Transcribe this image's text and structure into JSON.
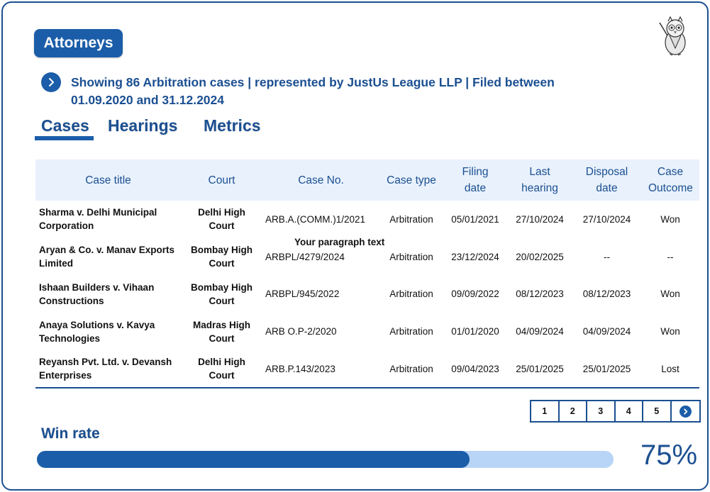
{
  "header": {
    "title": "Attorneys",
    "summary_line1": "Showing 86 Arbitration cases | represented by JustUs League LLP | Filed between",
    "summary_line2": "01.09.2020 and 31.12.2024"
  },
  "icons": {
    "logo": "owl-professor-icon",
    "summary": "chevron-right-icon",
    "next_page": "chevron-right-icon"
  },
  "colors": {
    "brand": "#1b5da8",
    "brand_dark": "#1b4f91",
    "header_bg": "#e8f1fc",
    "bar_track": "#b8d5f7"
  },
  "tabs": [
    {
      "label": "Cases",
      "active": true
    },
    {
      "label": "Hearings",
      "active": false
    },
    {
      "label": "Metrics",
      "active": false
    }
  ],
  "table": {
    "headers": [
      "Case title",
      "Court",
      "Case No.",
      "Case type",
      "Filing date",
      "Last hearing",
      "Disposal date",
      "Case Outcome"
    ],
    "rows": [
      {
        "title": "Sharma v. Delhi Municipal Corporation",
        "court": "Delhi High Court",
        "case_no": "ARB.A.(COMM.)1/2021",
        "type": "Arbitration",
        "filing": "05/01/2021",
        "last_hearing": "27/10/2024",
        "disposal": "27/10/2024",
        "outcome": "Won"
      },
      {
        "title": "Aryan & Co. v. Manav Exports Limited",
        "court": "Bombay High Court",
        "case_no": "ARBPL/4279/2024",
        "type": "Arbitration",
        "filing": "23/12/2024",
        "last_hearing": "20/02/2025",
        "disposal": "--",
        "outcome": "--"
      },
      {
        "title": "Ishaan Builders v. Vihaan Constructions",
        "court": "Bombay High Court",
        "case_no": "ARBPL/945/2022",
        "type": "Arbitration",
        "filing": "09/09/2022",
        "last_hearing": "08/12/2023",
        "disposal": "08/12/2023",
        "outcome": "Won"
      },
      {
        "title": "Anaya Solutions v. Kavya Technologies",
        "court": "Madras High Court",
        "case_no": "ARB O.P-2/2020",
        "type": "Arbitration",
        "filing": "01/01/2020",
        "last_hearing": "04/09/2024",
        "disposal": "04/09/2024",
        "outcome": "Won"
      },
      {
        "title": "Reyansh Pvt. Ltd. v. Devansh Enterprises",
        "court": "Delhi High Court",
        "case_no": "ARB.P.143/2023",
        "type": "Arbitration",
        "filing": "09/04/2023",
        "last_hearing": "25/01/2025",
        "disposal": "25/01/2025",
        "outcome": "Lost"
      }
    ],
    "overlay_text": "Your paragraph text"
  },
  "pagination": {
    "pages": [
      "1",
      "2",
      "3",
      "4",
      "5"
    ]
  },
  "win_rate": {
    "label": "Win rate",
    "value_text": "75%",
    "fill_fraction": 0.75
  }
}
